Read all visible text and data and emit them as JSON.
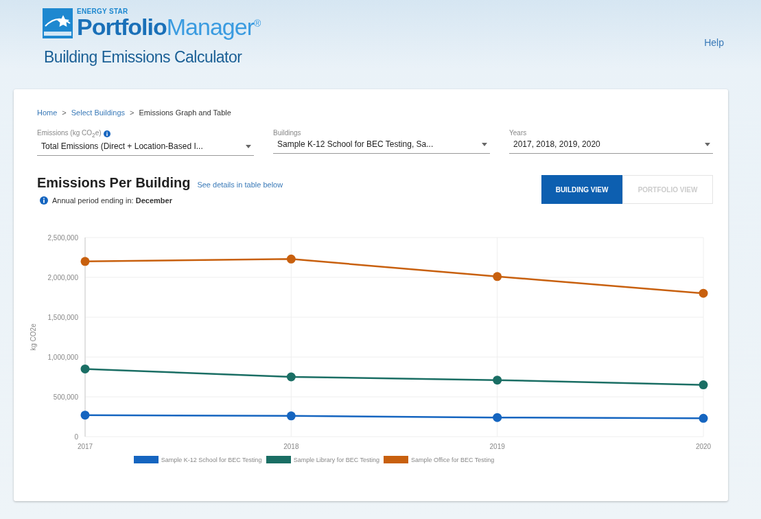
{
  "header": {
    "brand_small": "ENERGY STAR",
    "brand_strong": "Portfolio",
    "brand_light": "Manager",
    "brand_reg": "®",
    "subtitle": "Building Emissions Calculator",
    "help_link": "Help"
  },
  "breadcrumb": [
    {
      "label": "Home",
      "link": true
    },
    {
      "label": "Select Buildings",
      "link": true
    },
    {
      "label": "Emissions Graph and Table",
      "link": false
    }
  ],
  "breadcrumb_separator": ">",
  "filters": [
    {
      "label": "Emissions (kg CO$_{2}$e)",
      "kind": "with-info",
      "value": "Total Emissions (Direct + Location-Based I..."
    },
    {
      "label": "Buildings",
      "kind": "plain",
      "value": "Sample K-12 School for BEC Testing, Sa..."
    },
    {
      "label": "Years",
      "kind": "plain",
      "value": "2017, 2018, 2019, 2020"
    }
  ],
  "section": {
    "title": "Emissions Per Building",
    "details_link": "See details in table below",
    "period_note": "Annual period ending in: **December**"
  },
  "view_toggle": [
    {
      "label": "BUILDING VIEW",
      "selected": true
    },
    {
      "label": "PORTFOLIO VIEW",
      "selected": false
    }
  ],
  "chart_data": {
    "type": "line",
    "grid": true,
    "legend": true,
    "ylabel": "kg CO2e",
    "categories": [
      "2017",
      "2018",
      "2019",
      "2020"
    ],
    "ylim": [
      0,
      2500000
    ],
    "yticks": [
      {
        "value": 0,
        "label": "0"
      },
      {
        "value": 500000,
        "label": "500,000"
      },
      {
        "value": 1000000,
        "label": "1,000,000"
      },
      {
        "value": 1500000,
        "label": "1,500,000"
      },
      {
        "value": 2000000,
        "label": "2,000,000"
      },
      {
        "value": 2500000,
        "label": "2,500,000"
      }
    ],
    "series": [
      {
        "name": "Sample K-12 School for BEC Testing",
        "color": "#1565c0",
        "marker": "circle",
        "values": [
          270000,
          260000,
          240000,
          230000
        ]
      },
      {
        "name": "Sample Library for BEC Testing",
        "color": "#1a6e64",
        "marker": "circle",
        "values": [
          850000,
          750000,
          710000,
          650000
        ]
      },
      {
        "name": "Sample Office for BEC Testing",
        "color": "#c8600e",
        "marker": "circle",
        "values": [
          2200000,
          2230000,
          2010000,
          1800000
        ]
      }
    ]
  }
}
